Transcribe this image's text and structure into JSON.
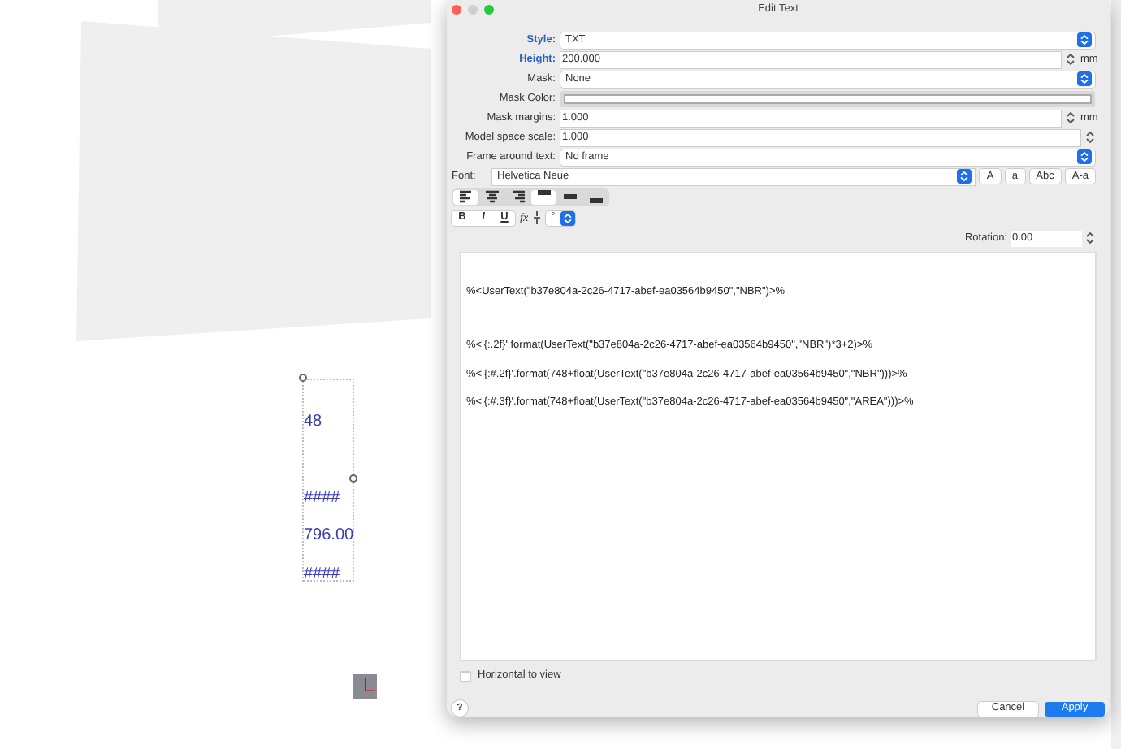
{
  "canvas": {
    "text_block": [
      "48",
      "####",
      "796.00",
      "####"
    ]
  },
  "dialog": {
    "title": "Edit Text",
    "fields": [
      {
        "kind": "select",
        "label": "Style:",
        "value": "TXT",
        "highlighted": true
      },
      {
        "kind": "number",
        "label": "Height:",
        "value": "200.000",
        "unit": "mm",
        "highlighted": true
      },
      {
        "kind": "select",
        "label": "Mask:",
        "value": "None",
        "highlighted": false
      },
      {
        "kind": "color",
        "label": "Mask Color:",
        "highlighted": false
      },
      {
        "kind": "number",
        "label": "Mask margins:",
        "value": "1.000",
        "unit": "mm",
        "highlighted": false
      },
      {
        "kind": "number",
        "label": "Model space scale:",
        "value": "1.000",
        "highlighted": false
      },
      {
        "kind": "select",
        "label": "Frame around text:",
        "value": "No frame",
        "highlighted": false
      }
    ],
    "font": {
      "label": "Font:",
      "value": "Helvetica Neue",
      "case_buttons": [
        "A",
        "a",
        "Abc",
        "A-a"
      ]
    },
    "alignment": [
      {
        "kind": "left",
        "selected": true
      },
      {
        "kind": "center",
        "selected": false
      },
      {
        "kind": "right",
        "selected": false
      },
      {
        "kind": "top",
        "selected": true
      },
      {
        "kind": "middle",
        "selected": false
      },
      {
        "kind": "bottom",
        "selected": false
      }
    ],
    "format": {
      "bold": "B",
      "italic": "I",
      "underline": "U",
      "function": "fx",
      "symbol": "°"
    },
    "rotation": {
      "label": "Rotation:",
      "value": "0.00"
    },
    "text_lines": [
      "%<UserText(\"b37e804a-2c26-4717-abef-ea03564b9450\",\"NBR\")>%",
      "%<'{:.2f}'.format(UserText(\"b37e804a-2c26-4717-abef-ea03564b9450\",\"NBR\")*3+2)>%",
      "%<'{:#.2f}'.format(748+float(UserText(\"b37e804a-2c26-4717-abef-ea03564b9450\",\"NBR\")))>%",
      "%<'{:#.3f}'.format(748+float(UserText(\"b37e804a-2c26-4717-abef-ea03564b9450\",\"AREA\")))>%"
    ],
    "horizontal_to_view": {
      "label": "Horizontal to view",
      "checked": false
    },
    "help": "?",
    "buttons": [
      {
        "label": "Cancel",
        "default": false
      },
      {
        "label": "Apply",
        "default": true
      }
    ]
  }
}
